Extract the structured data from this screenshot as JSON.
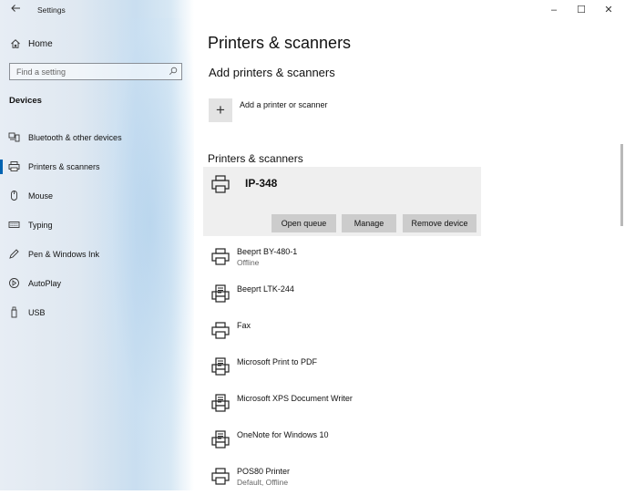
{
  "window": {
    "title": "Settings",
    "controls": {
      "minimize": "–",
      "maximize": "☐",
      "close": "✕"
    }
  },
  "sidebar": {
    "home_label": "Home",
    "search_placeholder": "Find a setting",
    "section_title": "Devices",
    "items": [
      {
        "label": "Bluetooth & other devices",
        "icon": "bluetooth-devices-icon"
      },
      {
        "label": "Printers & scanners",
        "icon": "printer-icon",
        "active": true
      },
      {
        "label": "Mouse",
        "icon": "mouse-icon"
      },
      {
        "label": "Typing",
        "icon": "keyboard-icon"
      },
      {
        "label": "Pen & Windows Ink",
        "icon": "pen-icon"
      },
      {
        "label": "AutoPlay",
        "icon": "autoplay-icon"
      },
      {
        "label": "USB",
        "icon": "usb-icon"
      }
    ]
  },
  "main": {
    "page_title": "Printers & scanners",
    "add_section_title": "Add printers & scanners",
    "add_button_label": "Add a printer or scanner",
    "list_section_title": "Printers & scanners",
    "selected_printer": {
      "name": "IP-348",
      "buttons": {
        "open_queue": "Open queue",
        "manage": "Manage",
        "remove_device": "Remove device"
      }
    },
    "printers": [
      {
        "name": "Beeprt BY-480-1",
        "status": "Offline",
        "icon": "printer-icon"
      },
      {
        "name": "Beeprt LTK-244",
        "status": "",
        "icon": "document-printer-icon"
      },
      {
        "name": "Fax",
        "status": "",
        "icon": "printer-icon"
      },
      {
        "name": "Microsoft Print to PDF",
        "status": "",
        "icon": "document-printer-icon"
      },
      {
        "name": "Microsoft XPS Document Writer",
        "status": "",
        "icon": "document-printer-icon"
      },
      {
        "name": "OneNote for Windows 10",
        "status": "",
        "icon": "document-printer-icon"
      },
      {
        "name": "POS80 Printer",
        "status": "Default, Offline",
        "icon": "printer-icon"
      }
    ]
  },
  "colors": {
    "accent": "#0063b1",
    "selected_bg": "#efefef",
    "button_bg": "#cccccc"
  }
}
